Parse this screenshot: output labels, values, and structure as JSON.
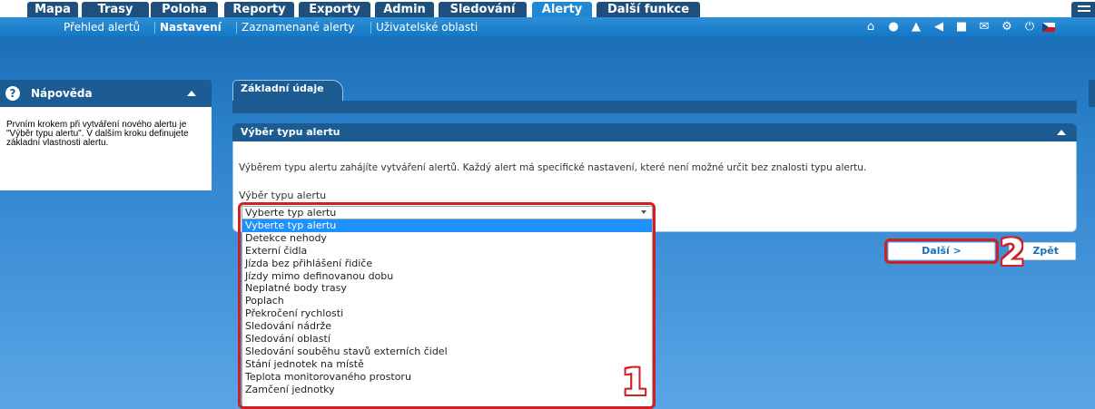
{
  "tabs": [
    {
      "label": "Mapa"
    },
    {
      "label": "Trasy"
    },
    {
      "label": "Poloha"
    },
    {
      "label": "Reporty"
    },
    {
      "label": "Exporty"
    },
    {
      "label": "Admin"
    },
    {
      "label": "Sledování"
    },
    {
      "label": "Alerty",
      "active": true
    },
    {
      "label": "Další funkce"
    }
  ],
  "submenu": [
    {
      "label": "Přehled alertů"
    },
    {
      "label": "Nastavení",
      "active": true
    },
    {
      "label": "Zaznamenané alerty"
    },
    {
      "label": "Uživatelské oblasti"
    }
  ],
  "toolbar_icons": [
    "home-icon",
    "chat-icon",
    "warning-icon",
    "sound-icon",
    "folder-icon",
    "mail-icon",
    "settings-icon",
    "power-icon",
    "czech-flag-icon"
  ],
  "help": {
    "title": "Nápověda",
    "text": "Prvním krokem při vytváření nového alertu je \"Výběr typu alertu\". V dalším kroku definujete základní vlastnosti alertu."
  },
  "content_tab": "Základní údaje",
  "section": {
    "title": "Výběr typu alertu",
    "description": "Výběrem typu alertu zahájíte vytváření alertů. Každý alert má specifické nastavení, které není možné určit bez znalosti typu alertu.",
    "select_label": "Výběr typu alertu",
    "select_value": "Vyberte typ alertu",
    "options": [
      "Vyberte typ alertu",
      "Detekce nehody",
      "Externí čidla",
      "Jízda bez přihlášení řidiče",
      "Jízdy mimo definovanou dobu",
      "Neplatné body trasy",
      "Poplach",
      "Překročení rychlosti",
      "Sledování nádrže",
      "Sledování oblastí",
      "Sledování souběhu stavů externích čidel",
      "Stání jednotek na místě",
      "Teplota monitorovaného prostoru",
      "Zamčení jednotky"
    ],
    "selected_option": "Vyberte typ alertu"
  },
  "buttons": {
    "next": "Další >",
    "back": "Zpět"
  },
  "annotations": {
    "marker_1": "1",
    "marker_2": "2"
  },
  "colors": {
    "tab_bg": "#1f4f7d",
    "tab_active": "#1e88d2",
    "panel_header": "#1c5c92",
    "selection": "#1e90ff",
    "annotation": "#d11f26"
  }
}
